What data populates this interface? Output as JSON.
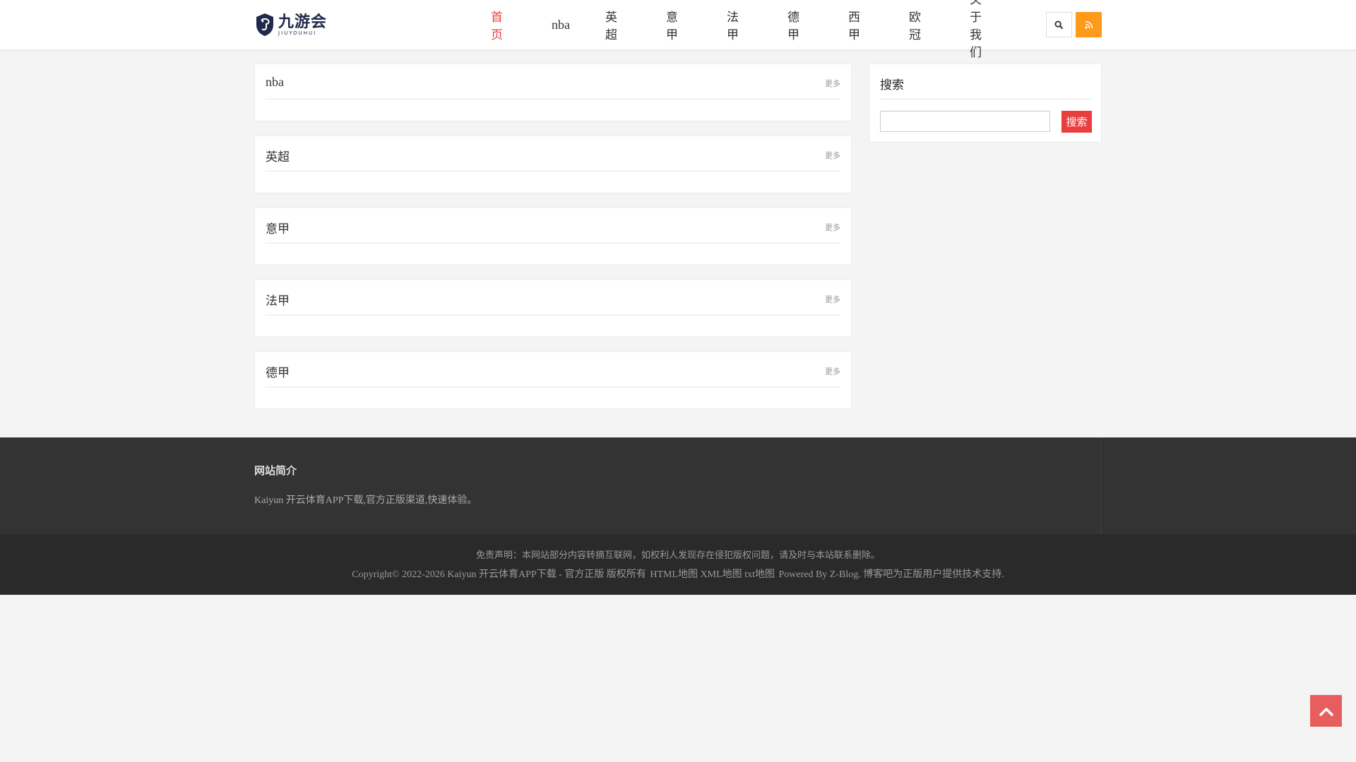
{
  "header": {
    "logo_cn": "九游会",
    "logo_en": "JIUYOUHUI",
    "nav": [
      {
        "label": "首页",
        "active": true
      },
      {
        "label": "nba"
      },
      {
        "label": "英超"
      },
      {
        "label": "意甲"
      },
      {
        "label": "法甲"
      },
      {
        "label": "德甲"
      },
      {
        "label": "西甲"
      },
      {
        "label": "欧冠"
      },
      {
        "label": "关于我们"
      }
    ],
    "search_icon": "search-icon",
    "rss_icon": "rss-icon"
  },
  "sections": [
    {
      "title": "nba",
      "more": "更多"
    },
    {
      "title": "英超",
      "more": "更多"
    },
    {
      "title": "意甲",
      "more": "更多"
    },
    {
      "title": "法甲",
      "more": "更多"
    },
    {
      "title": "德甲",
      "more": "更多"
    }
  ],
  "sidebar": {
    "title": "搜索",
    "input_value": "",
    "button_label": "搜索"
  },
  "footer": {
    "title": "网站简介",
    "text": "Kaiyun 开云体育APP下载,官方正版渠道,快速体验。"
  },
  "bottom": {
    "disclaimer": "免责声明：本网站部分内容转摘互联网，如权利人发现存在侵犯版权问题，请及时与本站联系删除。",
    "copyright": "Copyright© 2022-2026 Kaiyun 开云体育APP下载 - 官方正版 版权所有",
    "links": [
      "HTML地图",
      "XML地图",
      "txt地图"
    ],
    "powered": "Powered By Z-Blog. 博客吧为正版用户提供技术支持."
  },
  "colors": {
    "accent": "#e83e3e",
    "rss": "#ff9a1a",
    "footer_bg": "#333333",
    "bottom_bg": "#2a2a2a"
  }
}
